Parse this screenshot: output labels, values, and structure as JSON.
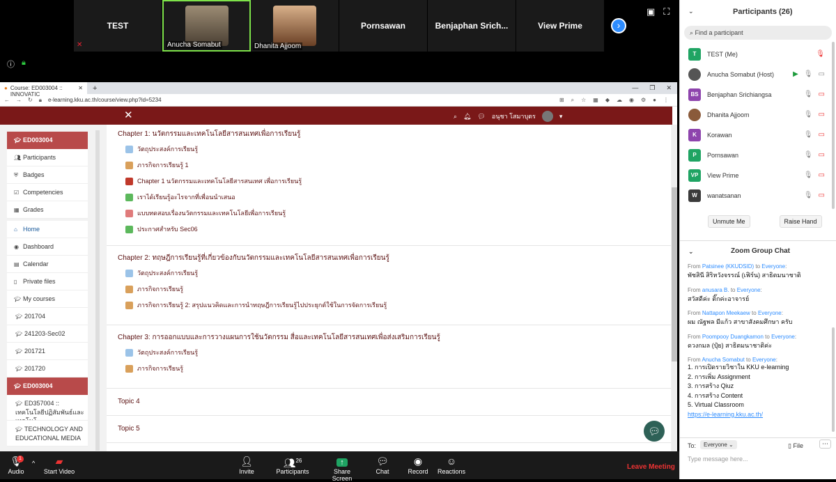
{
  "video": {
    "tiles": [
      {
        "name": "TEST",
        "label": "",
        "muted": true
      },
      {
        "name": "",
        "label": "Anucha Somabut",
        "active": true
      },
      {
        "name": "",
        "label": "Dhanita Ajjoom"
      },
      {
        "name": "Pornsawan",
        "label": ""
      },
      {
        "name": "Benjaphan  Srich...",
        "label": ""
      },
      {
        "name": "View Prime",
        "label": ""
      }
    ]
  },
  "browser": {
    "tab_title": "Course: ED003004 :: INNOVATIC",
    "url": "e-learning.kku.ac.th/course/view.php?id=5234"
  },
  "moodle": {
    "user_name": "อนุชา โสมาบุตร",
    "nav": {
      "course_code": "ED003004",
      "course_items": [
        "Participants",
        "Badges",
        "Competencies",
        "Grades"
      ],
      "main_items": [
        "Home",
        "Dashboard",
        "Calendar",
        "Private files",
        "My courses"
      ],
      "courses": [
        "201704",
        "241203-Sec02",
        "201721",
        "201720"
      ],
      "active_course": "ED003004",
      "courses_after": [
        "ED357004 :: เทคโนโลยีปฏิสัมพันธ์และเทคโนโ",
        "TECHNOLOGY AND EDUCATIONAL MEDIA"
      ]
    },
    "sections": [
      {
        "title": "Chapter 1: นวัตกรรมและเทคโนโลยีสารสนเทศเพื่อการเรียนรู้",
        "activities": [
          {
            "label": "วัตถุประสงค์การเรียนรู้",
            "type": "page"
          },
          {
            "label": "ภารกิจการเรียนรู้ 1",
            "type": "book"
          },
          {
            "label": "Chapter 1 นวัตกรรมและเทคโนโลยีสารสนเทศ เพื่อการเรียนรู้",
            "type": "pdf"
          },
          {
            "label": "เราได้เรียนรู้อะไรจากที่เพื่อนนำเสนอ",
            "type": "forum"
          },
          {
            "label": "แบบทดสอบเรื่องนวัตกรรมและเทคโนโลยีเพื่อการเรียนรู้",
            "type": "quiz"
          },
          {
            "label": "ประกาศสำหรับ Sec06",
            "type": "forum"
          }
        ]
      },
      {
        "title": "Chapter 2: ทฤษฎีการเรียนรู้ที่เกี่ยวข้องกับนวัตกรรมและเทคโนโลยีสารสนเทศเพื่อการเรียนรู้",
        "activities": [
          {
            "label": "วัตถุประสงค์การเรียนรู้",
            "type": "page"
          },
          {
            "label": "ภารกิจการเรียนรู้",
            "type": "book"
          },
          {
            "label": "ภารกิจการเรียนรู้ 2: สรุปแนวคิดและการนำทฤษฎีการเรียนรู้ไปประยุกต์ใช้ในการจัดการเรียนรู้",
            "type": "book"
          }
        ]
      },
      {
        "title": "Chapter 3: การออกแบบและการวางแผนการใช้นวัตกรรม สื่อและเทคโนโลยีสารสนเทศเพื่อส่งเสริมการเรียนรู้",
        "activities": [
          {
            "label": "วัตถุประสงค์การเรียนรู้",
            "type": "page"
          },
          {
            "label": "ภารกิจการเรียนรู้",
            "type": "book"
          }
        ]
      }
    ],
    "topics": [
      "Topic 4",
      "Topic 5"
    ]
  },
  "toolbar": {
    "audio": "Audio",
    "video": "Start Video",
    "invite": "Invite",
    "participants": "Participants",
    "participants_count": "26",
    "share": "Share Screen",
    "chat": "Chat",
    "record": "Record",
    "reactions": "Reactions",
    "leave": "Leave Meeting",
    "audio_badge": "1"
  },
  "participants": {
    "title": "Participants (26)",
    "search_placeholder": "Find a participant",
    "list": [
      {
        "initials": "T",
        "name": "TEST (Me)",
        "color": "#1fa463",
        "state": "muted-red"
      },
      {
        "initials": "",
        "name": "Anucha Somabut (Host)",
        "color": "#555555",
        "state": "host"
      },
      {
        "initials": "BS",
        "name": "Benjaphan Srichiangsa",
        "color": "#8e44ad",
        "state": "off"
      },
      {
        "initials": "",
        "name": "Dhanita Ajjoom",
        "color": "#8a5a3a",
        "state": "off"
      },
      {
        "initials": "K",
        "name": "Korawan",
        "color": "#8e44ad",
        "state": "off"
      },
      {
        "initials": "P",
        "name": "Pornsawan",
        "color": "#1fa463",
        "state": "off"
      },
      {
        "initials": "VP",
        "name": "View Prime",
        "color": "#1fa463",
        "state": "off"
      },
      {
        "initials": "W",
        "name": "wanatsanan",
        "color": "#3a3a3a",
        "state": "off"
      }
    ],
    "unmute_me": "Unmute Me",
    "raise_hand": "Raise Hand"
  },
  "chat": {
    "title": "Zoom Group Chat",
    "messages": [
      {
        "from": "Patsinee (KKUDSID)",
        "to": "Everyone",
        "text": "พัชสินี สิริหวังจรรณ์ (เฟิร์น) สาธิตมนาชาติ"
      },
      {
        "from": "anusara B.",
        "to": "Everyone",
        "text": "สวัสดีค่ะ  ติ๊กค่ะอาจารย์"
      },
      {
        "from": "Nattapon Meekaew",
        "to": "Everyone",
        "text": "ผม ณัฐพล มีแก้ว สาขาสังคมศึกษา ครับ"
      },
      {
        "from": "Poompooy Duangkamon",
        "to": "Everyone",
        "text": "ดวงกมล (ปุ๋ย) สาธิตมนาชาติค่ะ"
      },
      {
        "from": "Anucha Somabut",
        "to": "Everyone",
        "lines": [
          "1. การเปิดรายวิชาใน KKU e-learning",
          "2. การเพิ่ม Assignment",
          "3. การสร้าง Qiuz",
          "4. การสร้าง Content",
          "5. Virtual Classroom"
        ],
        "link": "https://e-learning.kku.ac.th/"
      }
    ],
    "to_label": "To:",
    "to_value": "Everyone",
    "file": "File",
    "input_placeholder": "Type message here..."
  },
  "colors": {
    "moodle_bar": "#7a1818",
    "nav_head": "#b84a4a",
    "zoom_blue": "#2d8cff",
    "leave_red": "#e33333"
  }
}
